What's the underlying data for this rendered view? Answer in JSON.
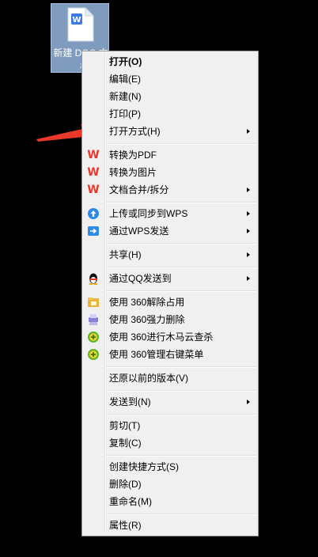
{
  "desktop_icon": {
    "label": "新建 DOC 文档",
    "label_visible_line1": "新建 DOC 文",
    "label_visible_line2": "档"
  },
  "menu": {
    "open": "打开(O)",
    "edit": "编辑(E)",
    "new": "新建(N)",
    "print": "打印(P)",
    "open_with": "打开方式(H)",
    "convert_pdf": "转换为PDF",
    "convert_image": "转换为图片",
    "merge_split": "文档合并/拆分",
    "upload_wps": "上传或同步到WPS",
    "send_wps": "通过WPS发送",
    "share": "共享(H)",
    "send_qq": "通过QQ发送到",
    "unlock_360": "使用 360解除占用",
    "force_delete_360": "使用 360强力删除",
    "scan_360": "使用 360进行木马云查杀",
    "manage_menu_360": "使用 360管理右键菜单",
    "restore_versions": "还原以前的版本(V)",
    "send_to": "发送到(N)",
    "cut": "剪切(T)",
    "copy": "复制(C)",
    "create_shortcut": "创建快捷方式(S)",
    "delete": "删除(D)",
    "rename": "重命名(M)",
    "properties": "属性(R)"
  },
  "icons": {
    "wps": "wps-icon",
    "cloud_upload": "cloud-upload-icon",
    "wps_send": "wps-send-icon",
    "qq": "qq-penguin-icon",
    "unlock_360": "360-unlock-icon",
    "shredder_360": "360-shredder-icon",
    "guard_360": "360-guard-icon"
  },
  "colors": {
    "background": "#000000",
    "menu_bg": "#f0f0f0",
    "arrow": "#e8392b",
    "wps_red": "#e8392b",
    "icon_selected": "#7f9bbd"
  }
}
